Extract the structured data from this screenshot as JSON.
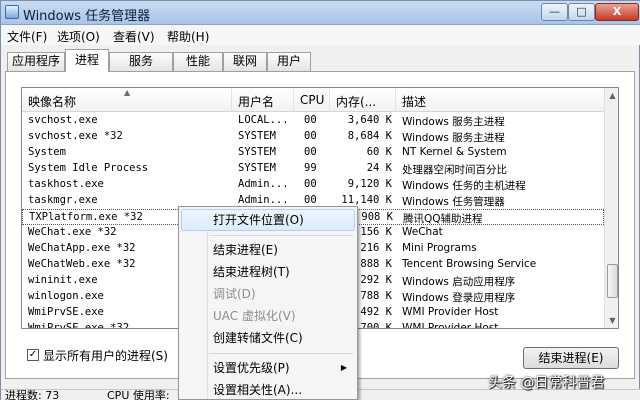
{
  "window": {
    "title": "Windows 任务管理器",
    "min": "—",
    "max": "□",
    "close": "X"
  },
  "menu": [
    "文件(F)",
    "选项(O)",
    "查看(V)",
    "帮助(H)"
  ],
  "tabs": [
    "应用程序",
    "进程",
    "服务",
    "性能",
    "联网",
    "用户"
  ],
  "active_tab": "进程",
  "columns": {
    "name": "映像名称",
    "user": "用户名",
    "cpu": "CPU",
    "mem": "内存(...",
    "desc": "描述"
  },
  "rows": [
    {
      "name": "svchost.exe",
      "user": "LOCAL...",
      "cpu": "00",
      "mem": "3,640 K",
      "desc": "Windows 服务主进程"
    },
    {
      "name": "svchost.exe *32",
      "user": "SYSTEM",
      "cpu": "00",
      "mem": "8,684 K",
      "desc": "Windows 服务主进程"
    },
    {
      "name": "System",
      "user": "SYSTEM",
      "cpu": "00",
      "mem": "60 K",
      "desc": "NT Kernel & System"
    },
    {
      "name": "System Idle Process",
      "user": "SYSTEM",
      "cpu": "99",
      "mem": "24 K",
      "desc": "处理器空闲时间百分比"
    },
    {
      "name": "taskhost.exe",
      "user": "Admin...",
      "cpu": "00",
      "mem": "9,120 K",
      "desc": "Windows 任务的主机进程"
    },
    {
      "name": "taskmgr.exe",
      "user": "Admin...",
      "cpu": "00",
      "mem": "11,140 K",
      "desc": "Windows 任务管理器"
    },
    {
      "name": "TXPlatform.exe *32",
      "user": "",
      "cpu": "",
      "mem": "908 K",
      "desc": "腾讯QQ辅助进程"
    },
    {
      "name": "WeChat.exe *32",
      "user": "",
      "cpu": "",
      "mem": "156 K",
      "desc": "WeChat"
    },
    {
      "name": "WeChatApp.exe *32",
      "user": "",
      "cpu": "",
      "mem": "216 K",
      "desc": "Mini Programs"
    },
    {
      "name": "WeChatWeb.exe *32",
      "user": "",
      "cpu": "",
      "mem": "888 K",
      "desc": "Tencent Browsing Service"
    },
    {
      "name": "wininit.exe",
      "user": "",
      "cpu": "",
      "mem": "292 K",
      "desc": "Windows 启动应用程序"
    },
    {
      "name": "winlogon.exe",
      "user": "",
      "cpu": "",
      "mem": "788 K",
      "desc": "Windows 登录应用程序"
    },
    {
      "name": "WmiPrvSE.exe",
      "user": "",
      "cpu": "",
      "mem": "492 K",
      "desc": "WMI Provider Host"
    },
    {
      "name": "WmiPrvSE.exe *32",
      "user": "",
      "cpu": "",
      "mem": "700 K",
      "desc": "WMI Provider Host"
    }
  ],
  "show_all": {
    "label": "显示所有用户的进程(S)",
    "checked": "✓"
  },
  "end_process_label": "结束进程(E)",
  "status": {
    "processes": "进程数: 73",
    "cpu": "CPU 使用率:"
  },
  "context_menu": {
    "open_location": "打开文件位置(O)",
    "end_process": "结束进程(E)",
    "end_tree": "结束进程树(T)",
    "debug": "调试(D)",
    "uac": "UAC 虚拟化(V)",
    "dump": "创建转储文件(C)",
    "priority": "设置优先级(P)",
    "affinity": "设置相关性(A)..."
  },
  "watermark": "头条 @日常科普君"
}
